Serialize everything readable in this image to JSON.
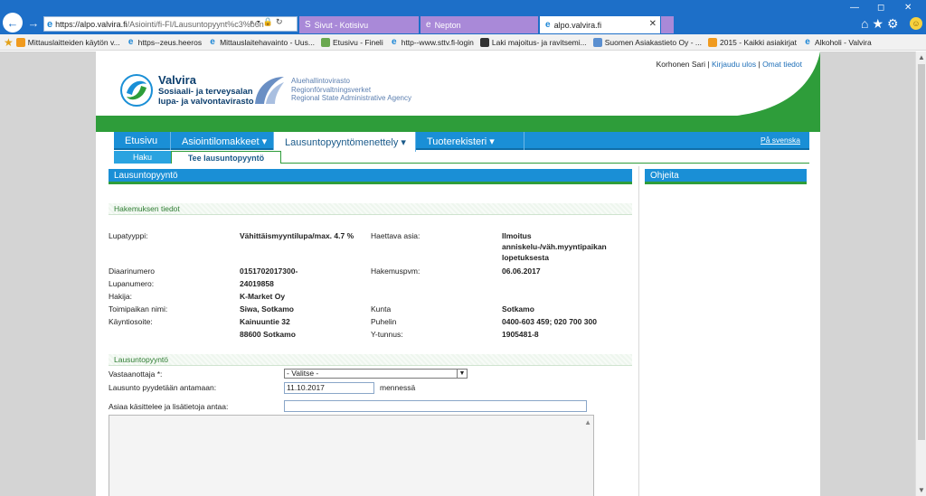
{
  "browser": {
    "url_main": "https://alpo.valvira.fi",
    "url_rest": "/Asiointi/fi-FI/Lausuntopyynt%c3%b6n",
    "tabs": [
      {
        "label": "Sivut - Kotisivu"
      },
      {
        "label": "Nepton"
      },
      {
        "label": "alpo.valvira.fi"
      }
    ],
    "favorites": [
      "Mittauslaitteiden käytön v...",
      "https--zeus.heeros",
      "Mittauslaitehavainto - Uus...",
      "Etusivu - Fineli",
      "http--www.sttv.fi-login",
      "Laki majoitus- ja ravitsemi...",
      "Suomen Asiakastieto Oy - ...",
      "2015 - Kaikki asiakirjat",
      "Alkoholi - Valvira"
    ]
  },
  "header": {
    "user_name": "Korhonen Sari",
    "separator": "|",
    "logout": "Kirjaudu ulos",
    "own_info": "Omat tiedot",
    "valvira_brand": "Valvira",
    "valvira_sub1": "Sosiaali- ja terveysalan",
    "valvira_sub2": "lupa- ja valvontavirasto",
    "avi_line1": "Aluehallintovirasto",
    "avi_line2": "Regionförvaltningsverket",
    "avi_line3": "Regional State Administrative Agency"
  },
  "menu": {
    "items": [
      {
        "label": "Etusivu"
      },
      {
        "label": "Asiointilomakkeet ▾"
      },
      {
        "label": "Lausuntopyyntömenettely ▾"
      },
      {
        "label": "Tuoterekisteri ▾"
      }
    ],
    "lang": "På svenska",
    "sub": {
      "haku": "Haku",
      "tee": "Tee lausuntopyyntö"
    }
  },
  "main": {
    "panel_title": "Lausuntopyyntö",
    "help_title": "Ohjeita",
    "section1": "Hakemuksen tiedot",
    "left": [
      {
        "label": "Lupatyyppi:",
        "value": "Vähittäismyyntilupa/max. 4.7 %"
      },
      {
        "label": "Diaarinumero",
        "value": "0151702017300-"
      },
      {
        "label": "Lupanumero:",
        "value": "24019858"
      },
      {
        "label": "Hakija:",
        "value": "K-Market Oy"
      },
      {
        "label": "Toimipaikan nimi:",
        "value": "Siwa, Sotkamo"
      },
      {
        "label": "Käyntiosoite:",
        "value": "Kainuuntie 32"
      }
    ],
    "address2": "88600 Sotkamo",
    "right": [
      {
        "label": "Haettava asia:",
        "value_lines": [
          "Ilmoitus",
          "anniskelu-/väh.myyntipaikan",
          "lopetuksesta"
        ]
      },
      {
        "label": "Hakemuspvm:",
        "value": "06.06.2017"
      },
      {
        "label": "Kunta",
        "value": "Sotkamo"
      },
      {
        "label": "Puhelin",
        "value": "0400-603 459; 020 700 300"
      },
      {
        "label": "Y-tunnus:",
        "value": "1905481-8"
      }
    ],
    "section2": "Lausuntopyyntö",
    "form": {
      "recipient_label": "Vastaanottaja *:",
      "recipient_value": "- Valitse -",
      "deadline_label": "Lausunto pyydetään antamaan:",
      "deadline_value": "11.10.2017",
      "deadline_suffix": "mennessä",
      "handler_label": "Asiaa käsittelee ja lisätietoja antaa:",
      "handler_value": ""
    }
  },
  "colors": {
    "accent_blue": "#1a8fd6",
    "brand_green": "#2e9d3a",
    "browser_blue": "#1d6fc8",
    "tab_purple": "#a989d8"
  }
}
